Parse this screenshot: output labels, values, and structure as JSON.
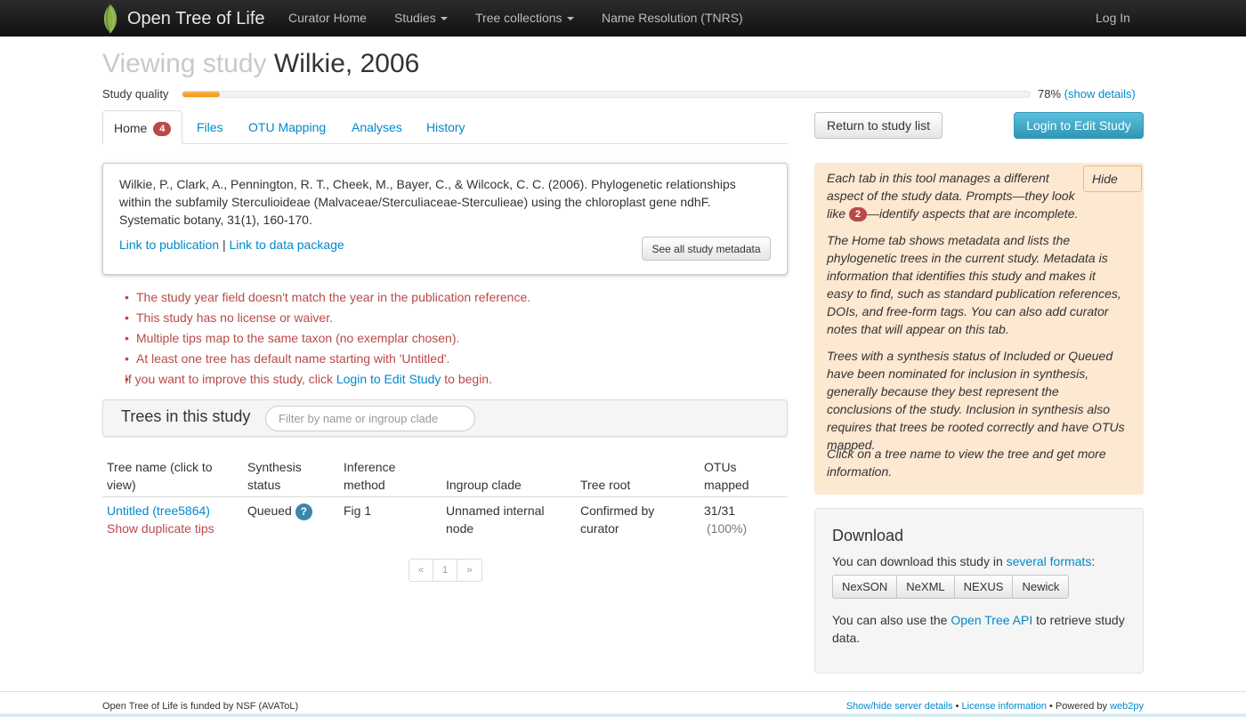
{
  "navbar": {
    "brand": "Open Tree of Life",
    "items": [
      "Curator Home",
      "Studies",
      "Tree collections",
      "Name Resolution (TNRS)"
    ],
    "login": "Log In"
  },
  "header": {
    "title_prefix": "Viewing study",
    "title_main": "Wilkie, 2006",
    "quality_label": "Study quality",
    "quality_percent": "78%",
    "quality_fraction": 0.78,
    "show_details": "(show details)"
  },
  "tabs": {
    "home": "Home",
    "home_badge": "4",
    "files": "Files",
    "otu_mapping": "OTU Mapping",
    "analyses": "Analyses",
    "history": "History"
  },
  "buttons": {
    "return": "Return to study list",
    "login_edit": "Login to Edit Study",
    "see_metadata": "See all study metadata"
  },
  "reference": {
    "text": "Wilkie, P., Clark, A., Pennington, R. T., Cheek, M., Bayer, C., & Wilcock, C. C. (2006). Phylogenetic relationships within the subfamily Sterculioideae (Malvaceae/Sterculiaceae-Sterculieae) using the chloroplast gene ndhF. Systematic botany, 31(1), 160-170.",
    "link_publication": "Link to publication",
    "separator": "|",
    "link_data": "Link to data package"
  },
  "warnings": {
    "items": [
      "The study year field doesn't match the year in the publication reference.",
      "This study has no license or waiver.",
      "Multiple tips map to the same taxon (no exemplar chosen).",
      "At least one tree has default name starting with 'Untitled'."
    ],
    "improve_pre": "If you want to improve this study, click",
    "improve_link": "Login to Edit Study",
    "improve_post": "to begin."
  },
  "trees": {
    "title": "Trees in this study",
    "filter_placeholder": "Filter by name or ingroup clade",
    "columns": [
      "Tree name (click to view)",
      "Synthesis status",
      "Inference method",
      "Ingroup clade",
      "Tree root",
      "OTUs mapped"
    ],
    "row": {
      "name": "Untitled (tree5864)",
      "duplicate": "Show duplicate tips",
      "status": "Queued",
      "status_help": "?",
      "method": "Fig 1",
      "clade": "Unnamed internal node",
      "root": "Confirmed by curator",
      "otus": "31/31",
      "otus_pct": "(100%)"
    },
    "pager": [
      "«",
      "1",
      "»"
    ]
  },
  "help": {
    "hide": "Hide",
    "p1_pre": "Each tab in this tool manages a different aspect of the study data. Prompts—they look like",
    "p1_badge": "2",
    "p1_post": "—identify aspects that are incomplete.",
    "p2": "The Home tab shows metadata and lists the phylogenetic trees in the current study. Metadata is information that identifies this study and makes it easy to find, such as standard publication references, DOIs, and free-form tags. You can also add curator notes that will appear on this tab.",
    "p3": "Trees with a synthesis status of Included or Queued have been nominated for inclusion in synthesis, generally because they best represent the conclusions of the study. Inclusion in synthesis also requires that trees be rooted correctly and have OTUs mapped.",
    "p4": "Click on a tree name to view the tree and get more information."
  },
  "download": {
    "title": "Download",
    "text_pre": "You can download this study in",
    "text_link": "several formats",
    "text_post": ":",
    "formats": [
      "NexSON",
      "NeXML",
      "NEXUS",
      "Newick"
    ],
    "api_pre": "You can also use the",
    "api_link": "Open Tree API",
    "api_post": "to retrieve study data."
  },
  "footer": {
    "left": "Open Tree of Life is funded by NSF (AVAToL)",
    "server": "Show/hide server details",
    "bullet": "•",
    "license": "License information",
    "powered": "Powered by",
    "web2py": "web2py"
  },
  "colors": {
    "link": "#0088cc",
    "warning": "#b94a48",
    "quality": "#f89406",
    "help_bg": "#fde8d2",
    "info_button": "#2f96b4"
  }
}
